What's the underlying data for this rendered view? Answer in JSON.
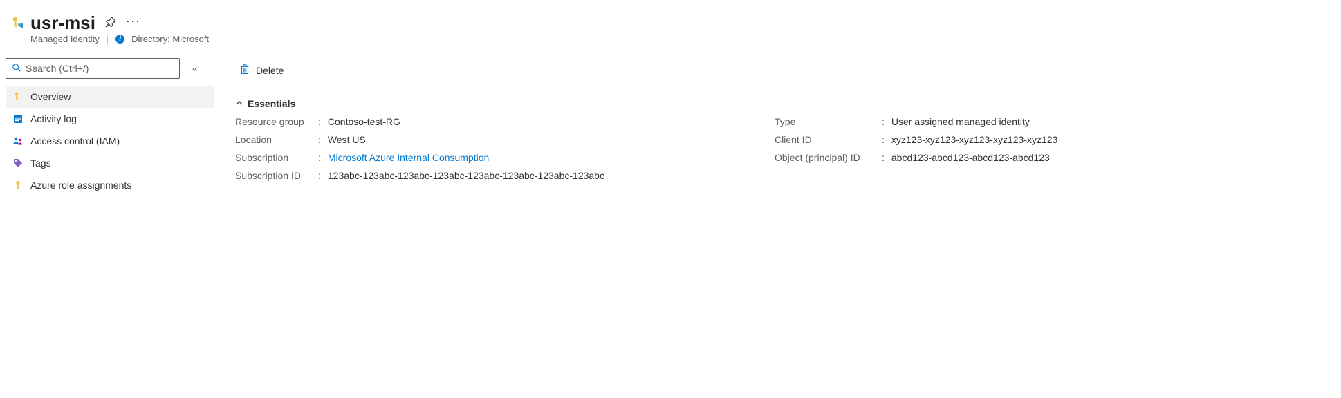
{
  "header": {
    "title": "usr-msi",
    "resource_type": "Managed Identity",
    "directory_label": "Directory: Microsoft"
  },
  "sidebar": {
    "search_placeholder": "Search (Ctrl+/)",
    "items": [
      {
        "label": "Overview",
        "icon": "key-icon",
        "active": true
      },
      {
        "label": "Activity log",
        "icon": "activity-log-icon",
        "active": false
      },
      {
        "label": "Access control (IAM)",
        "icon": "access-control-icon",
        "active": false
      },
      {
        "label": "Tags",
        "icon": "tags-icon",
        "active": false
      },
      {
        "label": "Azure role assignments",
        "icon": "role-assignments-icon",
        "active": false
      }
    ]
  },
  "toolbar": {
    "delete_label": "Delete"
  },
  "essentials": {
    "section_label": "Essentials",
    "left": [
      {
        "label": "Resource group",
        "value": "Contoso-test-RG",
        "link": false
      },
      {
        "label": "Location",
        "value": "West US",
        "link": false
      },
      {
        "label": "Subscription",
        "value": "Microsoft Azure Internal Consumption",
        "link": true
      },
      {
        "label": "Subscription ID",
        "value": "123abc-123abc-123abc-123abc-123abc-123abc-123abc-123abc",
        "link": false
      }
    ],
    "right": [
      {
        "label": "Type",
        "value": "User assigned managed identity",
        "link": false
      },
      {
        "label": "Client ID",
        "value": "xyz123-xyz123-xyz123-xyz123-xyz123",
        "link": false
      },
      {
        "label": "Object (principal) ID",
        "value": "abcd123-abcd123-abcd123-abcd123",
        "link": false
      }
    ]
  }
}
